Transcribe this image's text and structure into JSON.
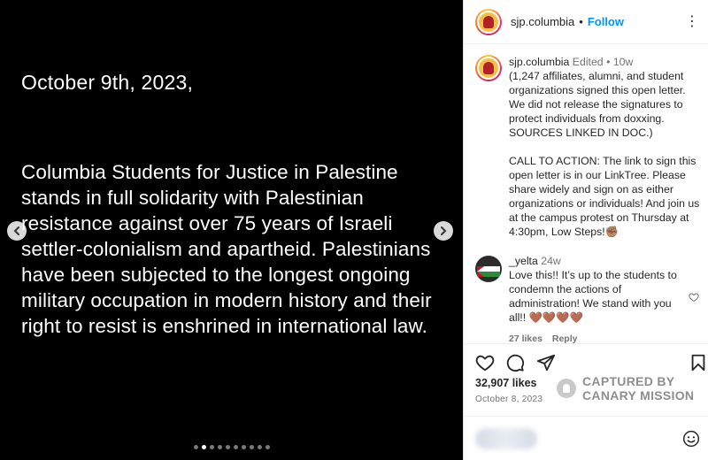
{
  "media": {
    "date_line": "October 9th, 2023,",
    "body_text": "Columbia Students for Justice in Palestine stands in full solidarity with Palestinian resistance against over 75 years of Israeli settler-colonialism and apartheid. Palestinians have been subjected to the longest ongoing military occupation in modern history and their right to resist is enshrined in international law.",
    "carousel_dot_count": 10,
    "carousel_active_index": 1
  },
  "header": {
    "username": "sjp.columbia",
    "separator": "•",
    "follow_label": "Follow",
    "more_label": "⋮"
  },
  "caption": {
    "username": "sjp.columbia",
    "edited": "Edited",
    "dot": "•",
    "age": "10w",
    "paragraph1": "(1,247 affiliates, alumni, and student organizations signed this open letter. We did not release the signatures to protect individuals from doxxing. SOURCES LINKED IN DOC.)",
    "paragraph2": "CALL TO ACTION: The link to sign this open letter is in our LinkTree. Please share widely and sign on as either organizations or individuals! And join us at the campus protest on Thursday at 4:30pm, Low Steps!✊🏽"
  },
  "comment": {
    "username": "_yelta",
    "age": "24w",
    "text": "Love this!! It’s up to the students to condemn the actions of administration! We stand with you all!! 🤎🤎🤎🤎",
    "likes": "27 likes",
    "reply_label": "Reply"
  },
  "post": {
    "likes": "32,907 likes",
    "date": "October 8, 2023"
  },
  "watermark": {
    "line1": "CAPTURED BY",
    "line2": "CANARY MISSION"
  },
  "colors": {
    "link_blue": "#0095f6",
    "muted": "#737373",
    "media_bg": "#000000"
  },
  "icons": {
    "prev": "chevron-left-icon",
    "next": "chevron-right-icon",
    "like": "heart-icon",
    "comment": "comment-icon",
    "share": "paper-plane-icon",
    "save": "bookmark-icon",
    "emoji": "smiley-icon"
  }
}
